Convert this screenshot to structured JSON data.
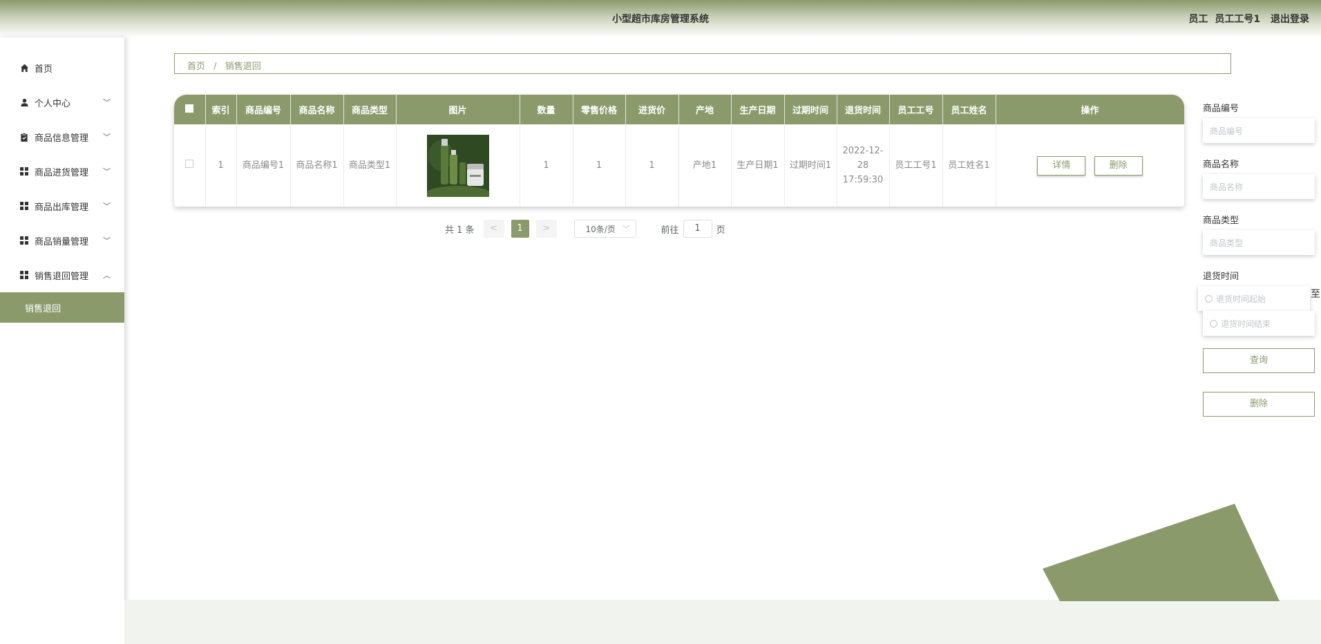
{
  "header": {
    "title": "小型超市库房管理系统",
    "role": "员工",
    "username": "员工工号1",
    "logout": "退出登录"
  },
  "sidebar": {
    "items": [
      {
        "label": "首页",
        "icon": "home-icon"
      },
      {
        "label": "个人中心",
        "icon": "user-icon"
      },
      {
        "label": "商品信息管理",
        "icon": "clipboard-icon"
      },
      {
        "label": "商品进货管理",
        "icon": "grid-icon"
      },
      {
        "label": "商品出库管理",
        "icon": "grid-icon"
      },
      {
        "label": "商品销量管理",
        "icon": "grid-icon"
      },
      {
        "label": "销售退回管理",
        "icon": "grid-icon"
      }
    ],
    "submenu": "销售退回"
  },
  "breadcrumb": {
    "home": "首页",
    "sep": "/",
    "current": "销售退回"
  },
  "table": {
    "headers": [
      "索引",
      "商品编号",
      "商品名称",
      "商品类型",
      "图片",
      "数量",
      "零售价格",
      "进货价",
      "产地",
      "生产日期",
      "过期时间",
      "退货时间",
      "员工工号",
      "员工姓名",
      "操作"
    ],
    "row": {
      "index": "1",
      "code": "商品编号1",
      "name": "商品名称1",
      "type": "商品类型1",
      "quantity": "1",
      "retail_price": "1",
      "purchase_price": "1",
      "origin": "产地1",
      "production_date": "生产日期1",
      "expiry": "过期时间1",
      "return_time": "2022-12-28 17:59:30",
      "staff_id": "员工工号1",
      "staff_name": "员工姓名1",
      "detail_btn": "详情",
      "delete_btn": "删除"
    }
  },
  "pager": {
    "total": "共 1 条",
    "prev": "<",
    "page": "1",
    "next": ">",
    "size": "10条/页",
    "goto": "前往",
    "goto_value": "1",
    "page_unit": "页"
  },
  "search": {
    "code_label": "商品编号",
    "code_placeholder": "商品编号",
    "name_label": "商品名称",
    "name_placeholder": "商品名称",
    "type_label": "商品类型",
    "type_placeholder": "商品类型",
    "time_label": "退货时间",
    "time_start": "退货时间起始",
    "time_to": "至",
    "time_end": "退货时间结束",
    "query_btn": "查询",
    "delete_btn": "删除"
  },
  "colors": {
    "accent": "#8b9a6b"
  }
}
